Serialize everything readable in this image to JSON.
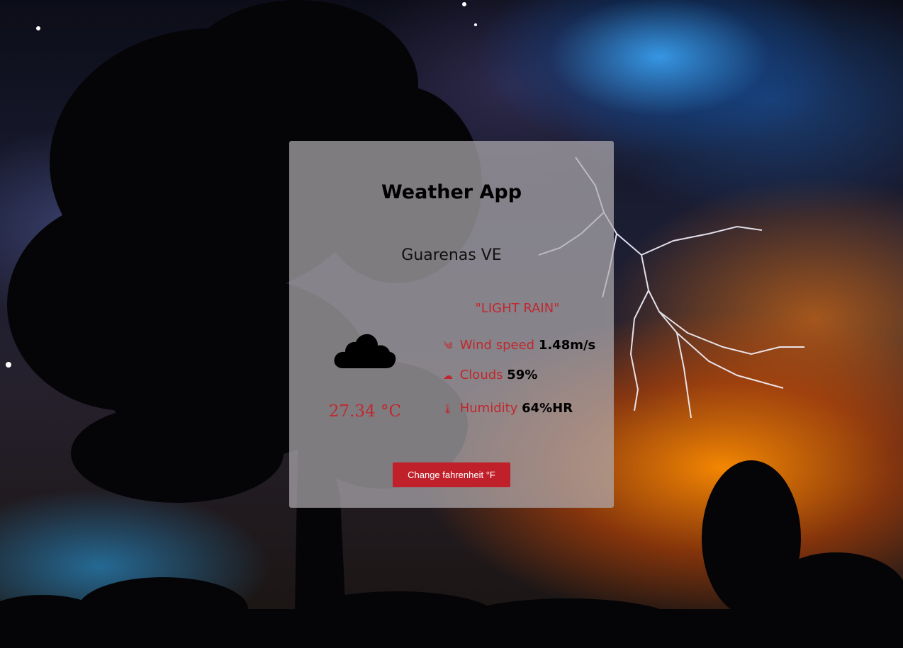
{
  "app": {
    "title": "Weather App"
  },
  "location": {
    "city": "Guarenas VE"
  },
  "weather": {
    "description": "\"LIGHT RAIN\"",
    "icon": "cloud-icon",
    "temperature": "27.34 °C",
    "wind": {
      "icon": "wind-icon",
      "label": "Wind speed",
      "value": "1.48m/s"
    },
    "clouds": {
      "icon": "cloud-small-icon",
      "label": "Clouds",
      "value": "59%"
    },
    "humidity": {
      "icon": "thermometer-icon",
      "label": "Humidity",
      "value": "64%HR"
    }
  },
  "actions": {
    "toggle_unit_label": "Change fahrenheit °F"
  },
  "colors": {
    "accent": "#c0282d",
    "button": "#c0202a",
    "card": "#afaaaf"
  }
}
